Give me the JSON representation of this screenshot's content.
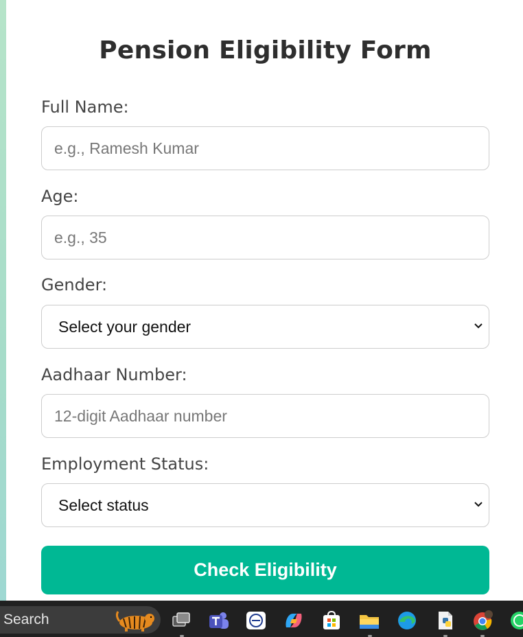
{
  "form": {
    "title": "Pension Eligibility Form",
    "fields": [
      {
        "label": "Full Name:",
        "placeholder": "e.g., Ramesh Kumar"
      },
      {
        "label": "Age:",
        "placeholder": "e.g., 35"
      },
      {
        "label": "Gender:",
        "selected": "Select your gender"
      },
      {
        "label": "Aadhaar Number:",
        "placeholder": "12-digit Aadhaar number"
      },
      {
        "label": "Employment Status:",
        "selected": "Select status"
      }
    ],
    "submit_label": "Check Eligibility"
  },
  "taskbar": {
    "search_label": "Search",
    "icons": [
      "task-view-icon",
      "teams-icon",
      "anydesk-app-icon",
      "copilot-icon",
      "microsoft-store-icon",
      "file-explorer-icon",
      "edge-icon",
      "python-file-icon",
      "chrome-icon",
      "whatsapp-icon"
    ]
  },
  "colors": {
    "accent": "#00b894",
    "title": "#2e2e2e",
    "label": "#444444",
    "placeholder": "#777777",
    "taskbar": "#202020"
  }
}
